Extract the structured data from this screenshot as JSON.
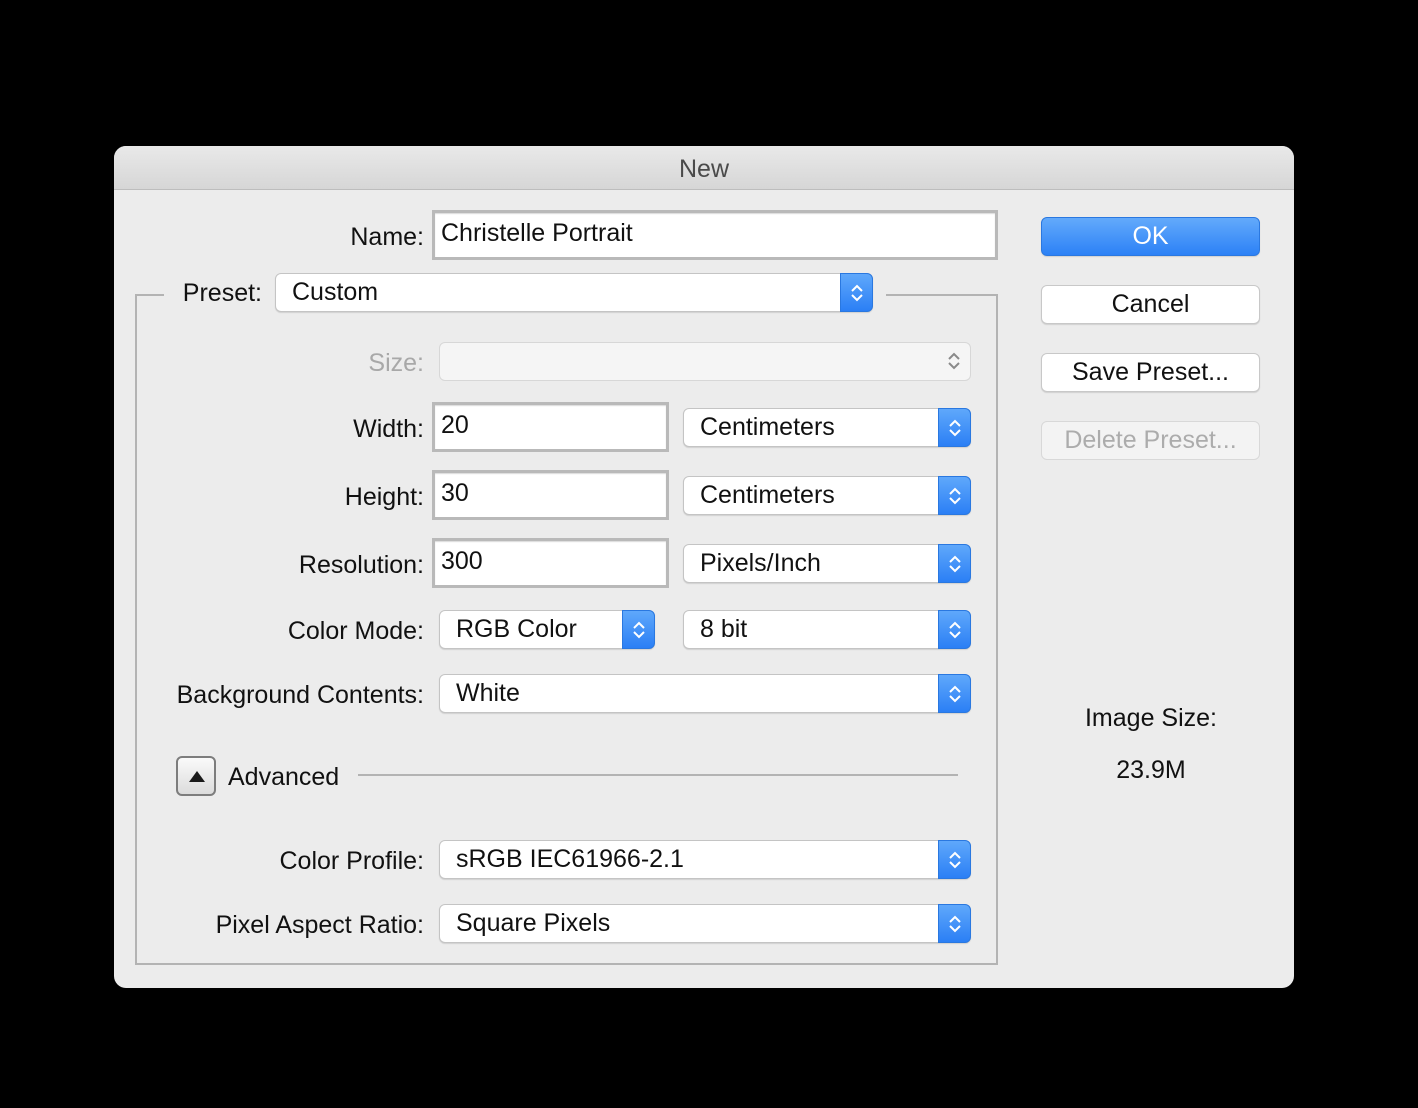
{
  "window": {
    "title": "New"
  },
  "form": {
    "name": {
      "label": "Name:",
      "value": "Christelle Portrait"
    },
    "preset": {
      "label": "Preset:",
      "value": "Custom"
    },
    "size": {
      "label": "Size:",
      "value": ""
    },
    "width": {
      "label": "Width:",
      "value": "20",
      "unit": "Centimeters"
    },
    "height": {
      "label": "Height:",
      "value": "30",
      "unit": "Centimeters"
    },
    "resolution": {
      "label": "Resolution:",
      "value": "300",
      "unit": "Pixels/Inch"
    },
    "color_mode": {
      "label": "Color Mode:",
      "value": "RGB Color",
      "depth": "8 bit"
    },
    "background": {
      "label": "Background Contents:",
      "value": "White"
    },
    "advanced": {
      "label": "Advanced",
      "expanded": true
    },
    "color_profile": {
      "label": "Color Profile:",
      "value": "sRGB IEC61966-2.1"
    },
    "pixel_aspect": {
      "label": "Pixel Aspect Ratio:",
      "value": "Square Pixels"
    }
  },
  "buttons": {
    "ok": "OK",
    "cancel": "Cancel",
    "save_preset": "Save Preset...",
    "delete_preset": "Delete Preset..."
  },
  "info": {
    "image_size_label": "Image Size:",
    "image_size_value": "23.9M"
  },
  "colors": {
    "accent": "#2c81f6",
    "dialog_bg": "#ececec",
    "backdrop": "#000000"
  }
}
